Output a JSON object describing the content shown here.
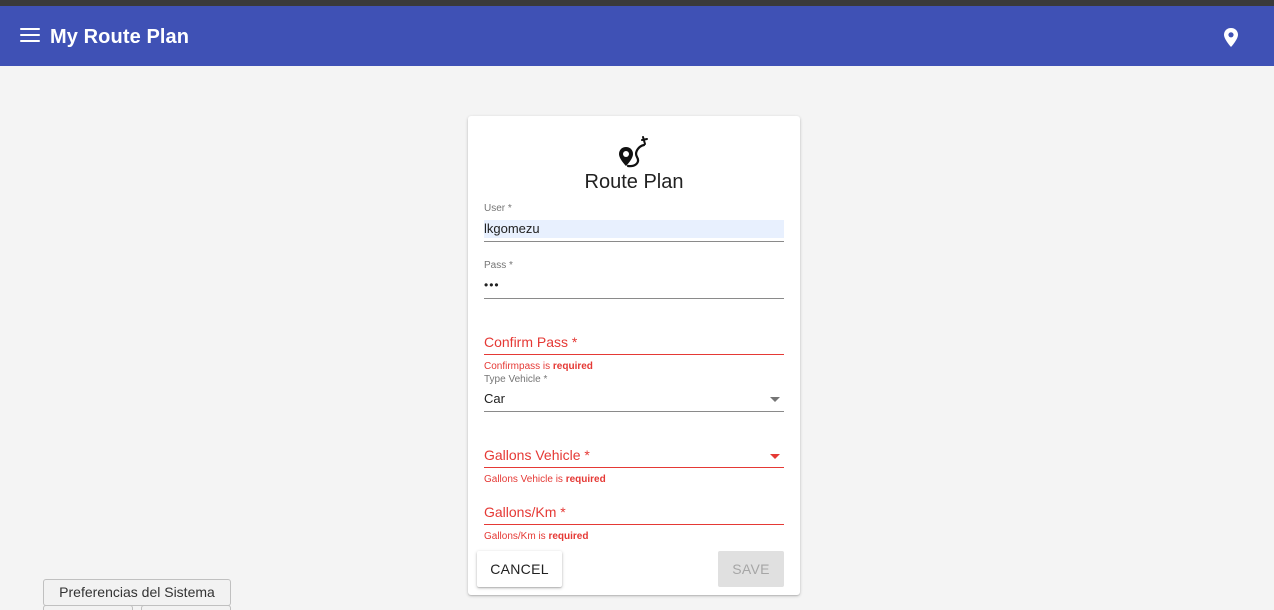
{
  "appbar": {
    "title": "My Route Plan",
    "menu_icon": "menu-icon",
    "location_icon": "location-pin-icon",
    "color": "#3f51b5"
  },
  "card": {
    "logo_icon": "route-plan-logo-icon",
    "title": "Route Plan",
    "user": {
      "label": "User *",
      "value": "lkgomezu"
    },
    "pass": {
      "label": "Pass *",
      "value": "•••"
    },
    "confirm_pass": {
      "label": "Confirm Pass *",
      "error_prefix": "Confirmpass is ",
      "error_strong": "required"
    },
    "type_vehicle": {
      "label": "Type Vehicle *",
      "value": "Car"
    },
    "gallons_vehicle": {
      "label": "Gallons Vehicle *",
      "error_prefix": "Gallons Vehicle is ",
      "error_strong": "required"
    },
    "gallons_km": {
      "label": "Gallons/Km *",
      "error_prefix": "Gallons/Km is ",
      "error_strong": "required"
    },
    "cancel_label": "CANCEL",
    "save_label": "SAVE",
    "error_color": "#e53935"
  },
  "taskbar": {
    "button_label": "Preferencias del Sistema"
  }
}
